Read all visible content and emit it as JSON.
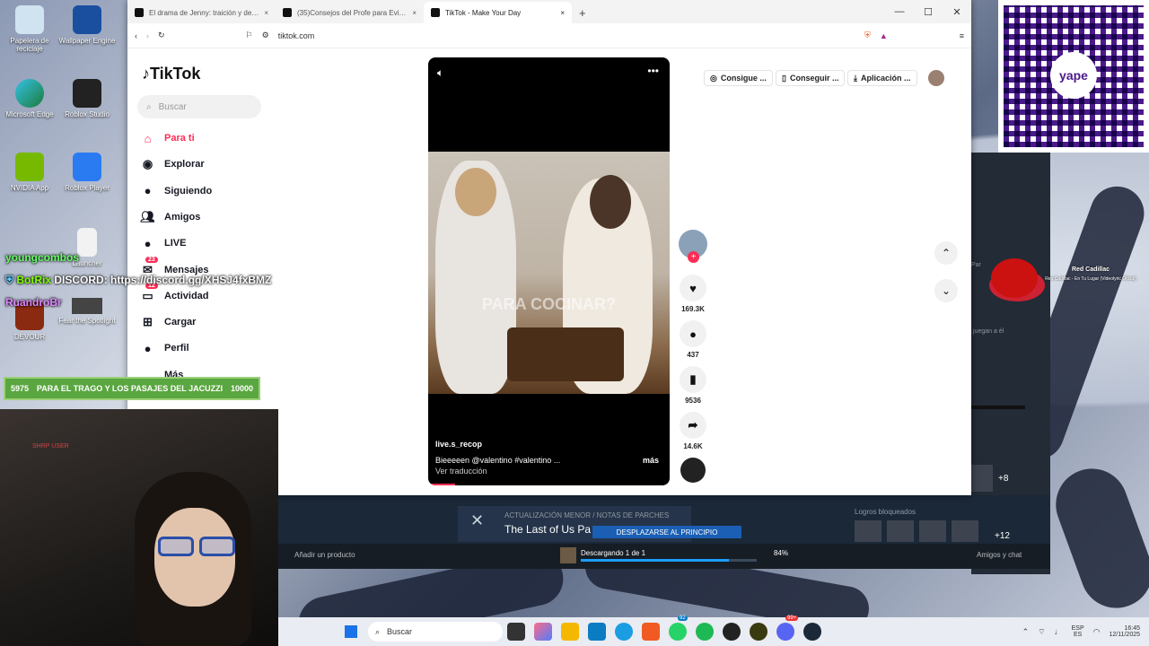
{
  "desktop": {
    "icons": [
      {
        "label": "Papelera de reciclaje"
      },
      {
        "label": "Wallpaper Engine"
      },
      {
        "label": "Microsoft Edge"
      },
      {
        "label": "Roblox Studio"
      },
      {
        "label": "NVIDIA App"
      },
      {
        "label": "Roblox Player"
      },
      {
        "label": "DEVOUR"
      },
      {
        "label": "Fear the Spotlight"
      },
      {
        "label": "Launcher"
      }
    ]
  },
  "browser": {
    "tabs": [
      {
        "title": "El drama de Jenny: traición y decisio"
      },
      {
        "title": "(35)Consejos del Profe para Evitar Tr"
      },
      {
        "title": "TikTok - Make Your Day"
      }
    ],
    "url": "tiktok.com",
    "new_tab": "+"
  },
  "tiktok": {
    "logo": "TikTok",
    "search_placeholder": "Buscar",
    "nav": [
      {
        "label": "Para ti"
      },
      {
        "label": "Explorar"
      },
      {
        "label": "Siguiendo"
      },
      {
        "label": "Amigos"
      },
      {
        "label": "LIVE"
      },
      {
        "label": "Mensajes",
        "badge": "23"
      },
      {
        "label": "Actividad",
        "badge": "12"
      },
      {
        "label": "Cargar"
      },
      {
        "label": "Perfil"
      },
      {
        "label": "Más"
      }
    ],
    "top": {
      "coins": "Consigue ...",
      "get": "Conseguir ...",
      "app": "Aplicación ..."
    },
    "video": {
      "username": "live.s_recop",
      "caption": "Bieeeeen @valentino  #valentino  ...",
      "more": "más",
      "translate": "Ver traducción",
      "overlay": "PARA COCINAR?"
    },
    "actions": {
      "likes": "169.3K",
      "comments": "437",
      "saves": "9536",
      "shares": "14.6K"
    }
  },
  "steam": {
    "update_label": "ACTUALIZACIÓN MENOR / NOTAS DE PARCHES",
    "update_title": "The Last of Us Pa",
    "scroll_btn": "DESPLAZARSE AL PRINCIPIO",
    "add_product": "Añadir un producto",
    "download": "Descargando 1 de 1",
    "percent": "84%",
    "progress": 0.84,
    "friends": "Amigos y chat",
    "locked": "Logros bloqueados",
    "plus8": "+8",
    "plus12": "+12",
    "side_text": "juegan a él",
    "side_partial": "Par"
  },
  "music": {
    "title": "Red Cadillac",
    "subtitle": "Red Cadillac - En Tu Lugar (Videolyric Oficial)"
  },
  "overlay": {
    "chat1": "youngcombos",
    "chat2_user": "BotRix",
    "chat2_msg": "DISCORD: https://discord.gg/XHSJ4fxBMZ",
    "chat3": "RuandroBr",
    "goal_left": "5975",
    "goal_text": "PARA EL TRAGO Y LOS PASAJES DEL JACUZZI",
    "goal_right": "10000",
    "webcam_sign": "SHRP USER",
    "qr_brand": "yape"
  },
  "taskbar": {
    "search": "Buscar",
    "lang1": "ESP",
    "lang2": "ES",
    "time": "16:45",
    "date": "12/11/2025",
    "badge1": "92",
    "badge2": "99+"
  }
}
